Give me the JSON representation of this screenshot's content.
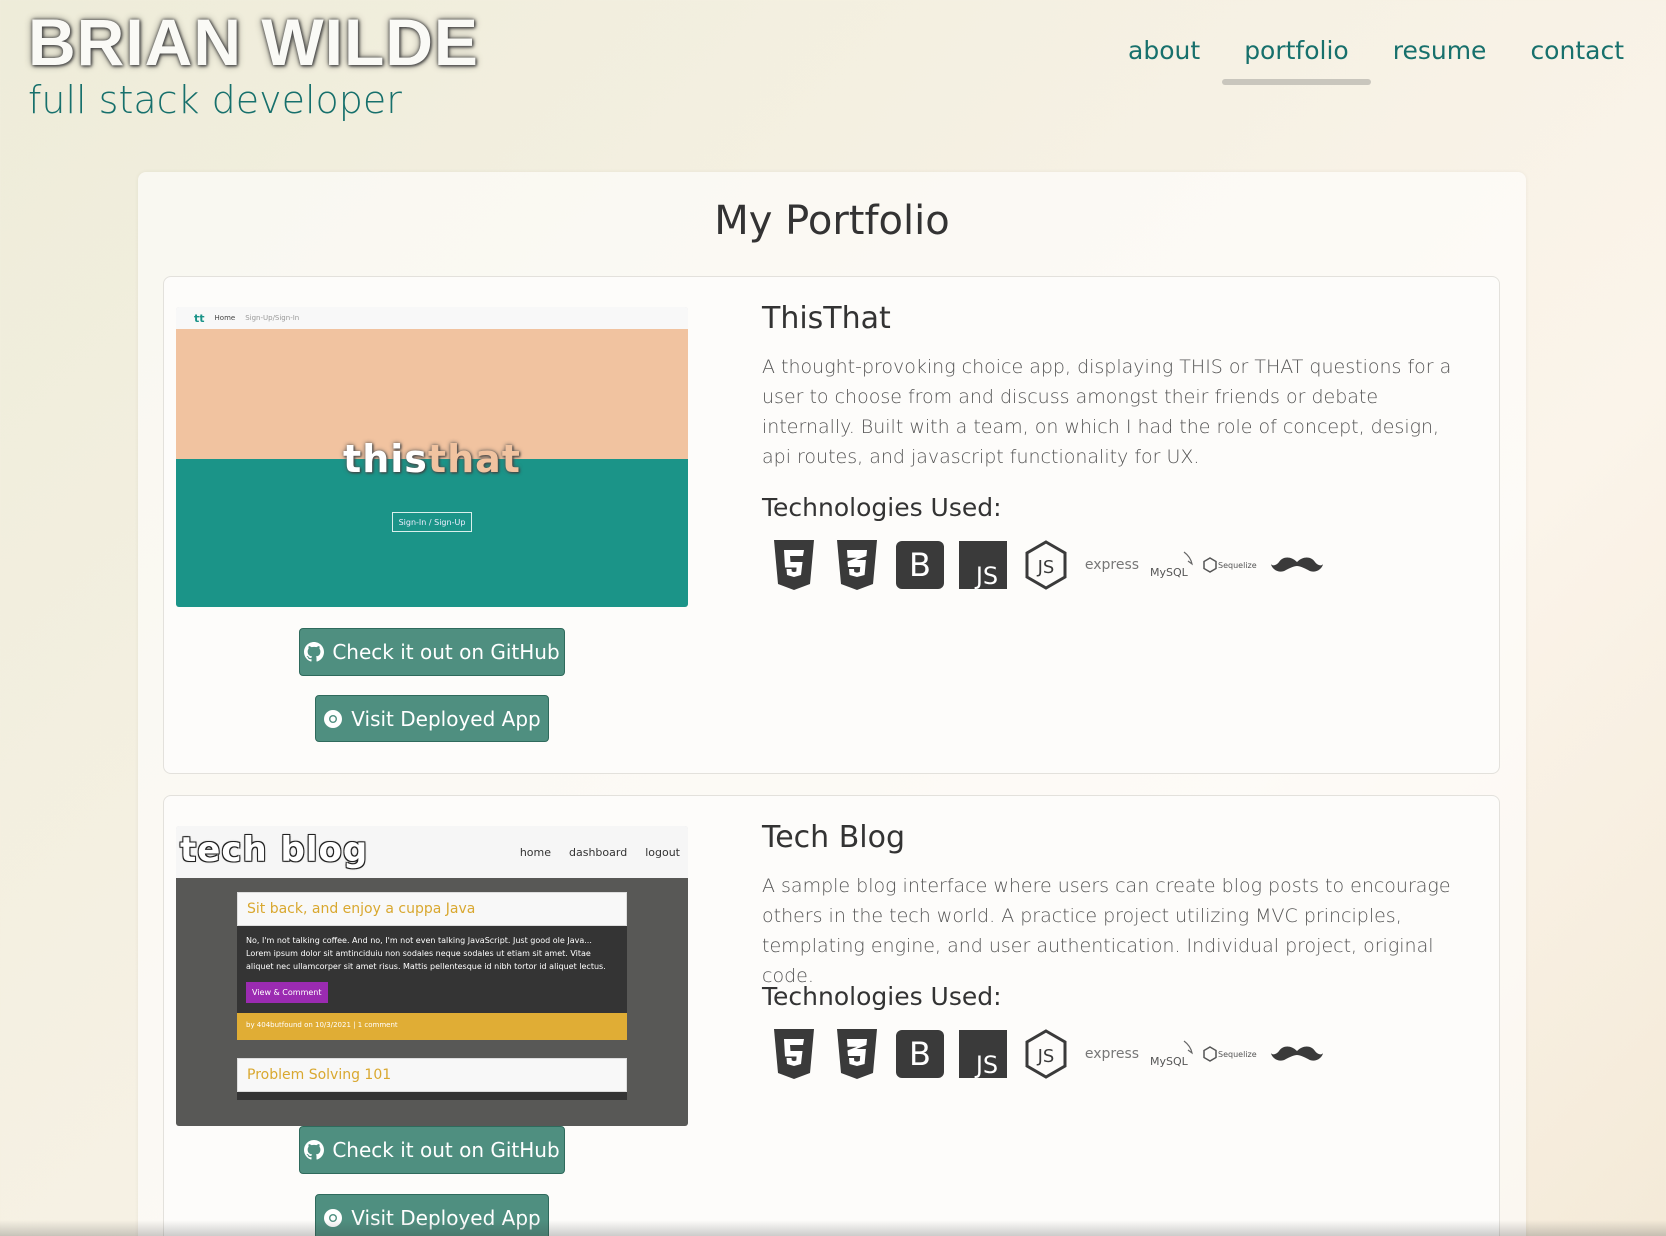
{
  "header": {
    "name": "BRIAN WILDE",
    "tagline": "full stack developer"
  },
  "nav": {
    "items": [
      {
        "label": "about"
      },
      {
        "label": "portfolio",
        "active": true
      },
      {
        "label": "resume"
      },
      {
        "label": "contact"
      }
    ]
  },
  "main": {
    "title": "My Portfolio",
    "projects": [
      {
        "title": "ThisThat",
        "description": "A thought-provoking choice app, displaying THIS or THAT questions for a user to choose from and discuss amongst their friends or debate internally. Built with a team, on which I had the role of concept, design, api routes, and javascript functionality for UX.",
        "tech_heading": "Technologies Used:",
        "github_label": "Check it out on GitHub",
        "deploy_label": "Visit Deployed App",
        "screenshot": {
          "logo": "tt",
          "nav_home": "Home",
          "nav_signin": "Sign-Up/Sign-In",
          "word_this": "this",
          "word_that": "that",
          "button": "Sign-In / Sign-Up"
        }
      },
      {
        "title": "Tech Blog",
        "description": "A sample blog interface where users can create blog posts to encourage others in the tech world. A practice project utilizing MVC principles, templating engine, and user authentication. Individual project, original code.",
        "tech_heading": "Technologies Used:",
        "github_label": "Check it out on GitHub",
        "deploy_label": "Visit Deployed App",
        "screenshot": {
          "logo": "tech blog",
          "links": [
            "home",
            "dashboard",
            "logout"
          ],
          "post1_title": "Sit back, and enjoy a cuppa Java",
          "post1_body": "No, I'm not talking coffee. And no, I'm not even talking JavaScript. Just good ole Java... Lorem ipsum dolor sit amtinciduiu non sodales neque sodales ut etiam sit amet. Vitae aliquet nec ullamcorper sit amet risus. Mattis pellentesque id nibh tortor id aliquet lectus.",
          "post1_button": "View & Comment",
          "post1_footer": "by 404butfound on 10/3/2021 | 1 comment",
          "post2_title": "Problem Solving 101"
        }
      }
    ],
    "tech_icons": [
      "html5-icon",
      "css3-icon",
      "bootstrap-icon",
      "javascript-icon",
      "nodejs-icon",
      "express-icon",
      "mysql-icon",
      "sequelize-icon",
      "handlebars-icon"
    ],
    "tech_labels": {
      "bootstrap": "B",
      "js": "JS",
      "express": "express",
      "mysql": "MySQL",
      "sequelize": "Sequelize"
    }
  },
  "colors": {
    "accent": "#17706c",
    "button": "#4f8f80"
  }
}
